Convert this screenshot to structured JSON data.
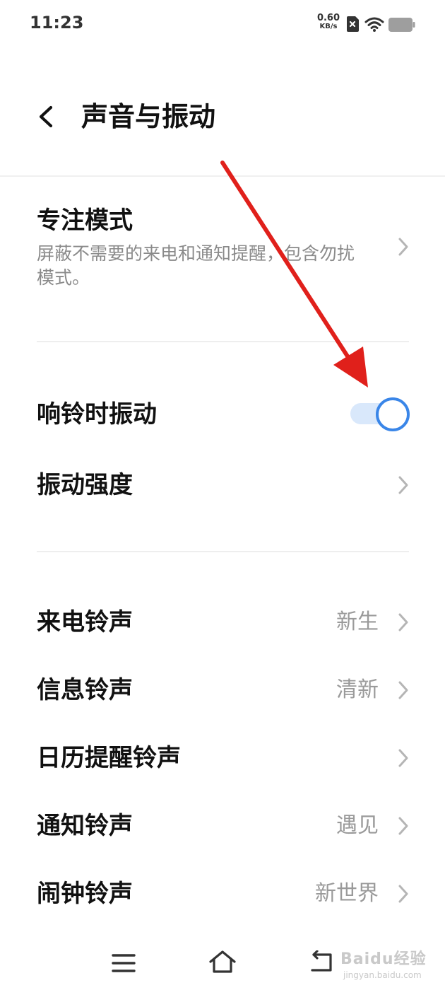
{
  "status_bar": {
    "time": "11:23",
    "net_speed_value": "0.60",
    "net_speed_unit": "KB/s",
    "icons": [
      "sim-x-icon",
      "wifi-icon",
      "battery-icon"
    ]
  },
  "header": {
    "title": "声音与振动",
    "back_icon": "chevron-left-icon"
  },
  "sections": {
    "focus_mode": {
      "title": "专注模式",
      "subtitle": "屏蔽不需要的来电和通知提醒，包含勿扰模式。"
    },
    "vibrate_on_ring": {
      "title": "响铃时振动",
      "enabled": true
    },
    "vibration_strength": {
      "title": "振动强度"
    },
    "ringtones": [
      {
        "title": "来电铃声",
        "value": "新生"
      },
      {
        "title": "信息铃声",
        "value": "清新"
      },
      {
        "title": "日历提醒铃声",
        "value": ""
      },
      {
        "title": "通知铃声",
        "value": "遇见"
      },
      {
        "title": "闹钟铃声",
        "value": "新世界"
      }
    ]
  },
  "nav_bar": {
    "icons": [
      "menu-icon",
      "home-icon",
      "back-icon"
    ]
  },
  "watermark": {
    "main": "Baidu经验",
    "sub": "jingyan.baidu.com"
  },
  "colors": {
    "accent": "#3a86e8",
    "toggle_track": "#d9e8fb",
    "annotation_arrow": "#e0201b",
    "secondary_text": "#8a8a8a"
  }
}
